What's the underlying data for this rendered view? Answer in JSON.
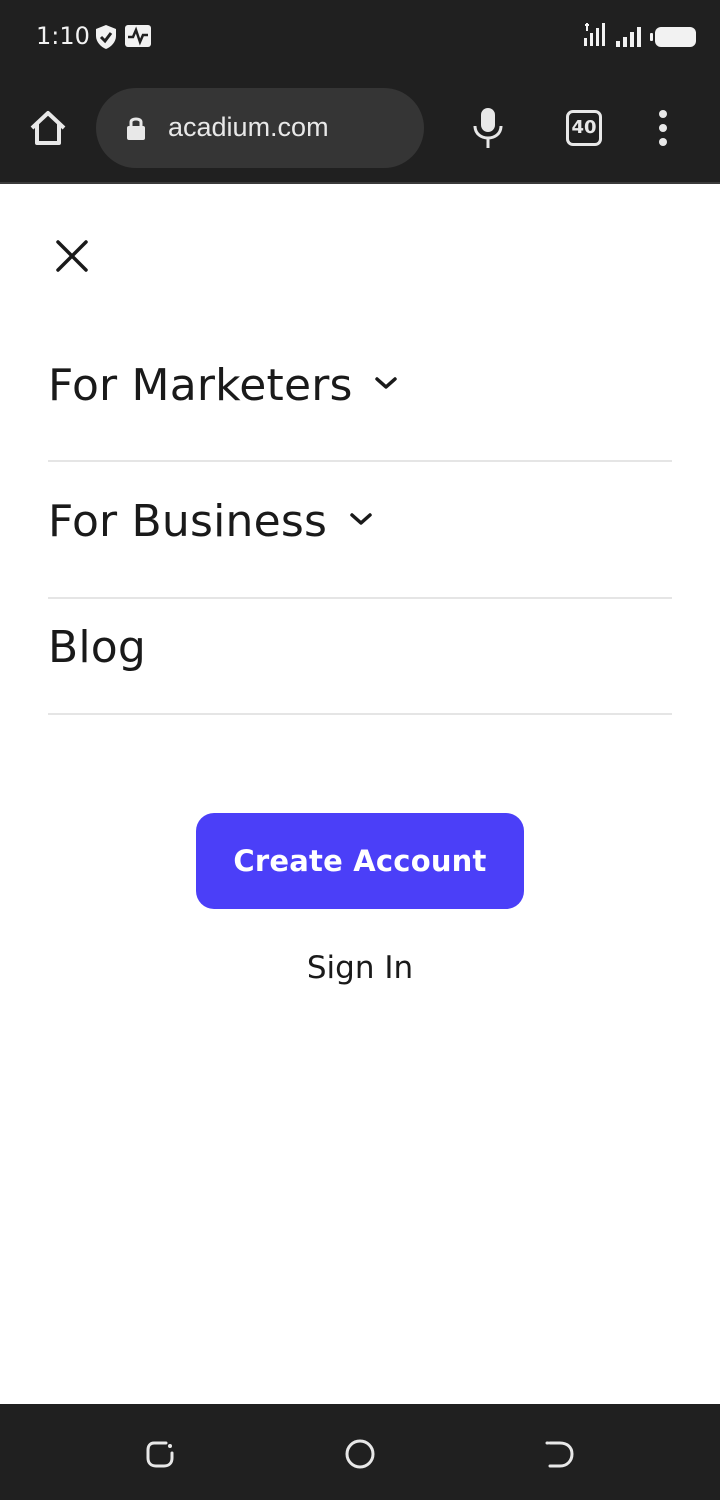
{
  "status_bar": {
    "time": "1:10",
    "icons": [
      "shield-check-icon",
      "activity-icon",
      "signal-icon",
      "signal-icon",
      "battery-icon"
    ]
  },
  "browser": {
    "url": "acadium.com",
    "tab_count": "40",
    "icons": [
      "home-icon",
      "lock-icon",
      "mic-icon",
      "more-vert-icon"
    ]
  },
  "menu": {
    "items": [
      {
        "label": "For Marketers",
        "has_dropdown": true
      },
      {
        "label": "For Business",
        "has_dropdown": true
      },
      {
        "label": "Blog",
        "has_dropdown": false
      }
    ],
    "create_account": "Create Account",
    "sign_in": "Sign In"
  },
  "colors": {
    "accent": "#4b3ff8",
    "system_bar": "#202020",
    "text": "#1a1a1a",
    "divider": "#e5e5e5"
  }
}
